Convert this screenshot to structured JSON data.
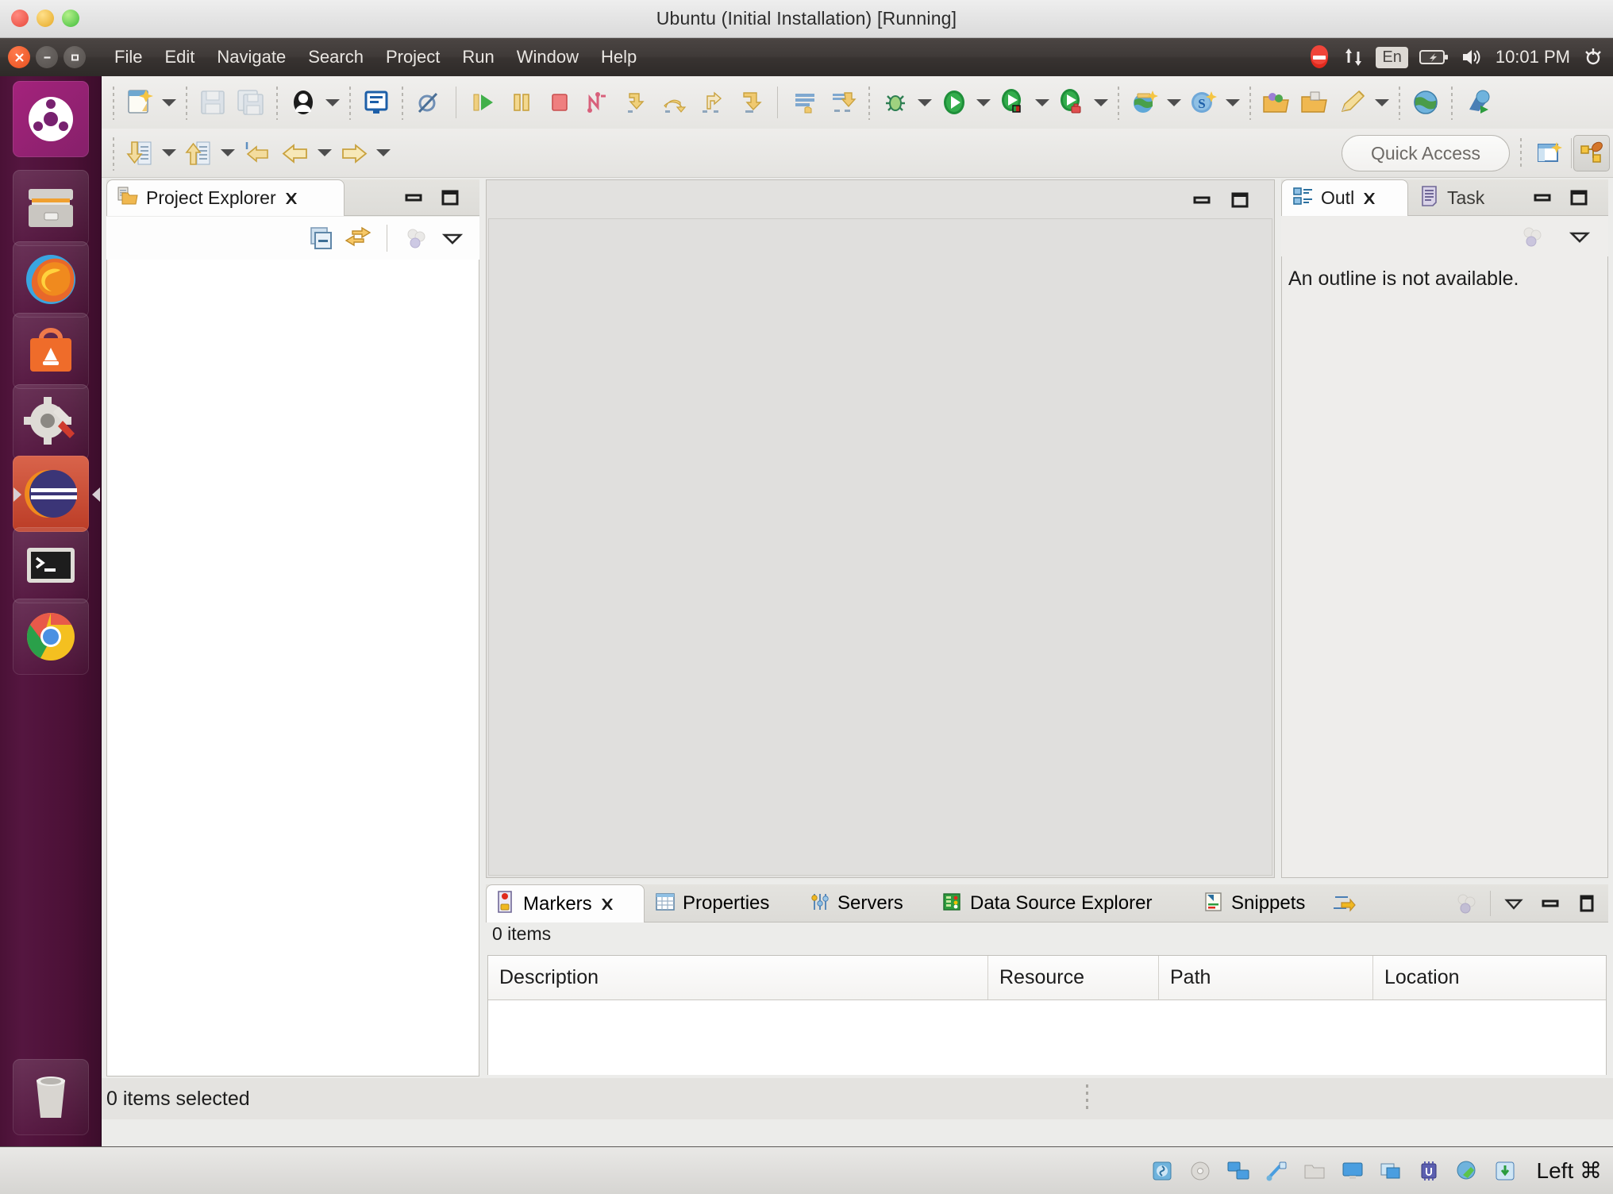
{
  "window": {
    "title": "Ubuntu (Initial Installation) [Running]",
    "lights": [
      "close-light",
      "minimize-light",
      "zoom-light"
    ]
  },
  "menubar": {
    "window_controls": [
      {
        "name": "close",
        "glyph": "✕"
      },
      {
        "name": "minimize",
        "glyph": "−"
      },
      {
        "name": "maximize",
        "glyph": "□"
      }
    ],
    "items": [
      "File",
      "Edit",
      "Navigate",
      "Search",
      "Project",
      "Run",
      "Window",
      "Help"
    ],
    "tray": {
      "clock": "10:01 PM",
      "keyboard_layout": "En",
      "icons": [
        "do-not-disturb-icon",
        "network-updown-icon",
        "keyboard-layout-icon",
        "battery-icon",
        "volume-icon",
        "session-gear-icon"
      ]
    }
  },
  "launcher": {
    "items": [
      {
        "name": "ubuntu-dash",
        "label": "Dash home"
      },
      {
        "name": "files",
        "label": "Files"
      },
      {
        "name": "firefox",
        "label": "Firefox Web Browser"
      },
      {
        "name": "ubuntu-software",
        "label": "Ubuntu Software"
      },
      {
        "name": "system-settings",
        "label": "System Settings"
      },
      {
        "name": "eclipse",
        "label": "Eclipse",
        "running": true
      },
      {
        "name": "terminal",
        "label": "Terminal"
      },
      {
        "name": "chrome",
        "label": "Google Chrome"
      },
      {
        "name": "trash",
        "label": "Trash"
      }
    ]
  },
  "toolbar": {
    "row1": [
      {
        "name": "new-wizard-button",
        "icon": "new-file-icon",
        "dropdown": true
      },
      {
        "sep": true
      },
      {
        "name": "save-button",
        "icon": "save-icon",
        "disabled": true
      },
      {
        "name": "save-all-button",
        "icon": "save-all-icon",
        "disabled": true
      },
      {
        "sep": true
      },
      {
        "name": "open-type-button",
        "icon": "person-icon",
        "dropdown": true
      },
      {
        "sep": true
      },
      {
        "name": "open-console-button",
        "icon": "console-icon"
      },
      {
        "sep": true
      },
      {
        "name": "skip-breakpoints-button",
        "icon": "skip-breakpoints-icon"
      },
      {
        "sep-solid": true
      },
      {
        "name": "resume-button",
        "icon": "resume-icon"
      },
      {
        "name": "suspend-button",
        "icon": "suspend-icon"
      },
      {
        "name": "terminate-button",
        "icon": "terminate-stop-icon"
      },
      {
        "name": "disconnect-button",
        "icon": "disconnect-icon"
      },
      {
        "name": "step-into-button",
        "icon": "step-into-icon"
      },
      {
        "name": "step-over-button",
        "icon": "step-over-icon"
      },
      {
        "name": "step-return-button",
        "icon": "step-return-icon"
      },
      {
        "name": "drop-to-frame-button",
        "icon": "drop-to-frame-icon"
      },
      {
        "sep-solid": true
      },
      {
        "name": "open-task-button",
        "icon": "task-list-icon"
      },
      {
        "name": "synchronize-button",
        "icon": "sync-changes-icon"
      },
      {
        "sep": true
      },
      {
        "name": "debug-button",
        "icon": "debug-bug-icon",
        "dropdown": true
      },
      {
        "name": "run-button",
        "icon": "run-green-icon",
        "dropdown": true
      },
      {
        "name": "coverage-button",
        "icon": "coverage-icon",
        "dropdown": true
      },
      {
        "name": "profile-button",
        "icon": "profile-icon",
        "dropdown": true
      },
      {
        "sep": true
      },
      {
        "name": "new-dynamic-web-project-button",
        "icon": "globe-new-icon",
        "dropdown": true
      },
      {
        "name": "new-server-button",
        "icon": "s-new-icon",
        "dropdown": true
      },
      {
        "sep": true
      },
      {
        "name": "open-package-button",
        "icon": "open-folder-beans-icon"
      },
      {
        "name": "open-resource-button",
        "icon": "open-folder-icon"
      },
      {
        "name": "new-annotation-button",
        "icon": "pencil-icon",
        "dropdown": true
      },
      {
        "sep": true
      },
      {
        "name": "web-browser-button",
        "icon": "globe-icon"
      },
      {
        "sep": true
      },
      {
        "name": "run-on-server-button",
        "icon": "run-on-server-icon"
      }
    ],
    "row2": [
      {
        "name": "previous-annotation-button",
        "icon": "down-arrow-doc-icon",
        "dropdown": true
      },
      {
        "name": "next-annotation-button",
        "icon": "up-arrow-doc-icon",
        "dropdown": true
      },
      {
        "name": "last-edit-location-button",
        "icon": "back-to-edit-icon"
      },
      {
        "name": "back-button",
        "icon": "back-arrow-icon",
        "dropdown": true
      },
      {
        "name": "forward-button",
        "icon": "forward-arrow-icon",
        "dropdown": true
      }
    ],
    "quick_access_placeholder": "Quick Access",
    "open-perspective": "open-perspective-icon",
    "active-perspective": "java-ee-perspective-icon"
  },
  "project_explorer": {
    "tab_label": "Project Explorer",
    "tab_icon": "project-explorer-icon",
    "close_icon": "close-x-icon",
    "minimize_icon": "minimize-icon",
    "maximize_icon": "maximize-icon",
    "toolbar": [
      {
        "name": "collapse-all-button",
        "icon": "collapse-all-icon"
      },
      {
        "name": "link-with-editor-button",
        "icon": "link-editor-icon"
      },
      {
        "name": "view-menu-circles",
        "icon": "view-menu-circles-icon"
      },
      {
        "name": "view-menu-button",
        "icon": "view-menu-chevron-icon"
      }
    ],
    "items": []
  },
  "editor_area": {
    "minimize_icon": "minimize-icon",
    "maximize_icon": "maximize-icon",
    "content": ""
  },
  "outline": {
    "tabs": [
      {
        "label": "Outl",
        "icon": "outline-icon",
        "active": true,
        "closable": true
      },
      {
        "label": "Task",
        "icon": "task-list-icon",
        "active": false,
        "closable": false
      }
    ],
    "minimize_icon": "minimize-icon",
    "maximize_icon": "maximize-icon",
    "toolbar": [
      {
        "name": "view-menu-circles",
        "icon": "view-menu-circles-icon"
      },
      {
        "name": "view-menu-button",
        "icon": "view-menu-chevron-icon"
      }
    ],
    "message": "An outline is not available."
  },
  "markers": {
    "tabs": [
      {
        "label": "Markers",
        "icon": "markers-icon",
        "active": true,
        "closable": true
      },
      {
        "label": "Properties",
        "icon": "properties-icon",
        "active": false
      },
      {
        "label": "Servers",
        "icon": "servers-icon",
        "active": false
      },
      {
        "label": "Data Source Explorer",
        "icon": "data-source-explorer-icon",
        "active": false
      },
      {
        "label": "Snippets",
        "icon": "snippets-icon",
        "active": false
      }
    ],
    "extra_icon": "show-more-tabs-icon",
    "toolbar": [
      {
        "name": "view-menu-circles",
        "icon": "view-menu-circles-icon"
      },
      {
        "name": "view-menu-button",
        "icon": "view-menu-chevron-icon"
      },
      {
        "name": "minimize-button",
        "icon": "minimize-icon"
      },
      {
        "name": "maximize-button",
        "icon": "maximize-icon"
      }
    ],
    "count_label": "0 items",
    "columns": [
      "Description",
      "Resource",
      "Path",
      "Location"
    ],
    "rows": []
  },
  "status_bar": {
    "text": "0 items selected"
  },
  "os_taskbar": {
    "label": "Left ⌘",
    "icons": [
      "hard-disk-icon",
      "optical-disc-icon",
      "network-icon",
      "usb-icon",
      "shared-folder-icon",
      "display-icon",
      "windows-icon",
      "cpu-icon",
      "remote-icon",
      "capture-icon"
    ]
  },
  "colors": {
    "launcher_bg": "#4b1136",
    "menubar_bg": "#3b3634",
    "eclipse_bg": "#ececea",
    "panel_border": "#c0beb9",
    "accent_orange": "#e8501e",
    "white": "#ffffff"
  }
}
